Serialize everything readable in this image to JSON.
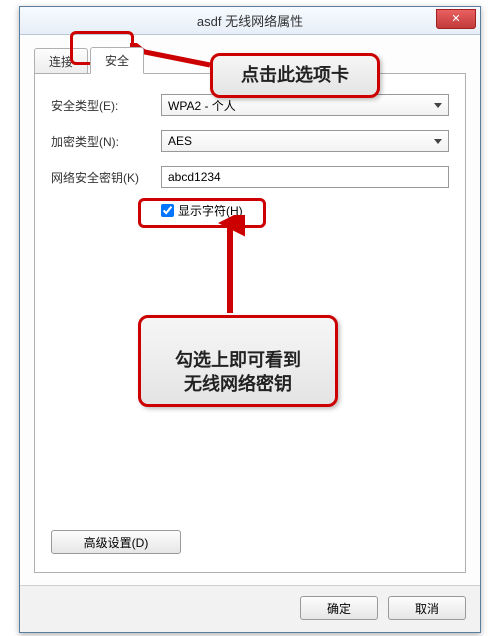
{
  "window": {
    "title": "asdf 无线网络属性",
    "close_symbol": "✕"
  },
  "tabs": {
    "connect": "连接",
    "security": "安全"
  },
  "form": {
    "security_type_label": "安全类型(E):",
    "security_type_value": "WPA2 - 个人",
    "encryption_label": "加密类型(N):",
    "encryption_value": "AES",
    "key_label": "网络安全密钥(K)",
    "key_value": "abcd1234",
    "show_chars_label": "显示字符(H)"
  },
  "buttons": {
    "advanced": "高级设置(D)",
    "ok": "确定",
    "cancel": "取消"
  },
  "annotations": {
    "callout_tab": "点击此选项卡",
    "callout_checkbox": "勾选上即可看到\n无线网络密钥"
  }
}
